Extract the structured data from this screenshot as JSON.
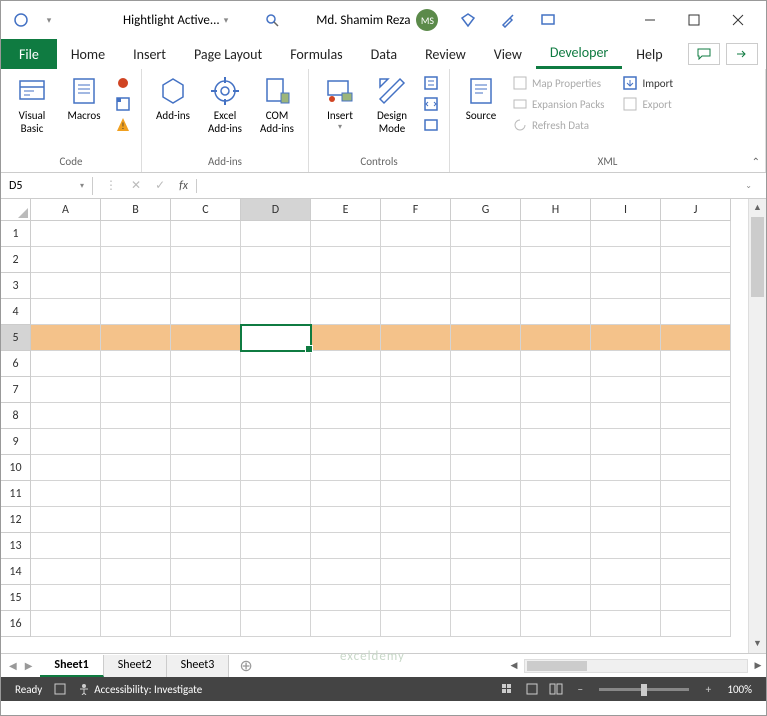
{
  "title": "Hightlight Active...",
  "user": {
    "name": "Md. Shamim Reza",
    "initials": "MS"
  },
  "tabs": [
    "Home",
    "Insert",
    "Page Layout",
    "Formulas",
    "Data",
    "Review",
    "View",
    "Developer",
    "Help"
  ],
  "activeTab": "Developer",
  "fileTab": "File",
  "ribbon": {
    "code": {
      "label": "Code",
      "visualBasic": "Visual Basic",
      "macros": "Macros"
    },
    "addins": {
      "label": "Add-ins",
      "addins": "Add-ins",
      "excel": "Excel Add-ins",
      "com": "COM Add-ins"
    },
    "controls": {
      "label": "Controls",
      "insert": "Insert",
      "design": "Design Mode"
    },
    "xml": {
      "label": "XML",
      "source": "Source",
      "mapProps": "Map Properties",
      "expansion": "Expansion Packs",
      "refresh": "Refresh Data",
      "import": "Import",
      "export": "Export"
    }
  },
  "nameBox": "D5",
  "formulaBar": "",
  "columns": [
    "A",
    "B",
    "C",
    "D",
    "E",
    "F",
    "G",
    "H",
    "I",
    "J"
  ],
  "rows": [
    1,
    2,
    3,
    4,
    5,
    6,
    7,
    8,
    9,
    10,
    11,
    12,
    13,
    14,
    15,
    16
  ],
  "activeCol": "D",
  "activeRow": 5,
  "highlightRow": 5,
  "sheets": [
    "Sheet1",
    "Sheet2",
    "Sheet3"
  ],
  "activeSheet": "Sheet1",
  "status": {
    "mode": "Ready",
    "accessibility": "Accessibility: Investigate",
    "zoom": "100%"
  },
  "watermark": "exceldemy"
}
